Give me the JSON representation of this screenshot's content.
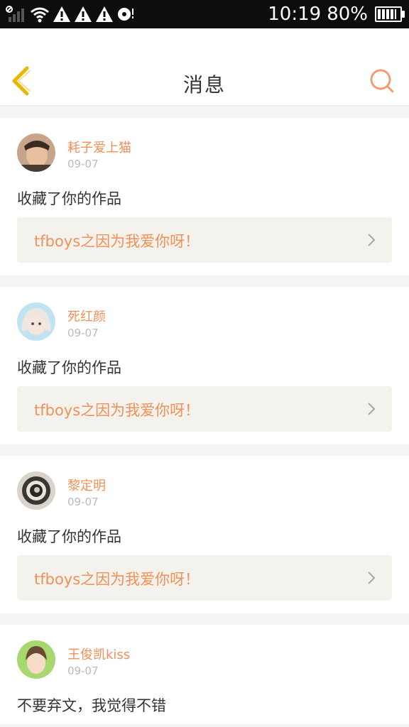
{
  "status_bar": {
    "time": "10:19",
    "battery": "80%"
  },
  "header": {
    "title": "消息"
  },
  "messages": [
    {
      "username": "耗子爱上猫",
      "time": "09-07",
      "action": "收藏了你的作品",
      "work_title": "tfboys之因为我爱你呀！"
    },
    {
      "username": "死红颜",
      "time": "09-07",
      "action": "收藏了你的作品",
      "work_title": "tfboys之因为我爱你呀！"
    },
    {
      "username": "黎定明",
      "time": "09-07",
      "action": "收藏了你的作品",
      "work_title": "tfboys之因为我爱你呀！"
    },
    {
      "username": "王俊凯kiss",
      "time": "09-07",
      "action": "不要弃文，我觉得不错"
    }
  ],
  "colors": {
    "accent": "#f0905a",
    "back_icon": "#e6b800",
    "search_icon": "#f0a070",
    "link_bg": "#f4f2ec"
  },
  "icons": [
    "signal-icon",
    "wifi-icon",
    "warning-icon",
    "record-icon",
    "battery-icon",
    "back-arrow-icon",
    "search-icon",
    "chevron-right-icon"
  ]
}
